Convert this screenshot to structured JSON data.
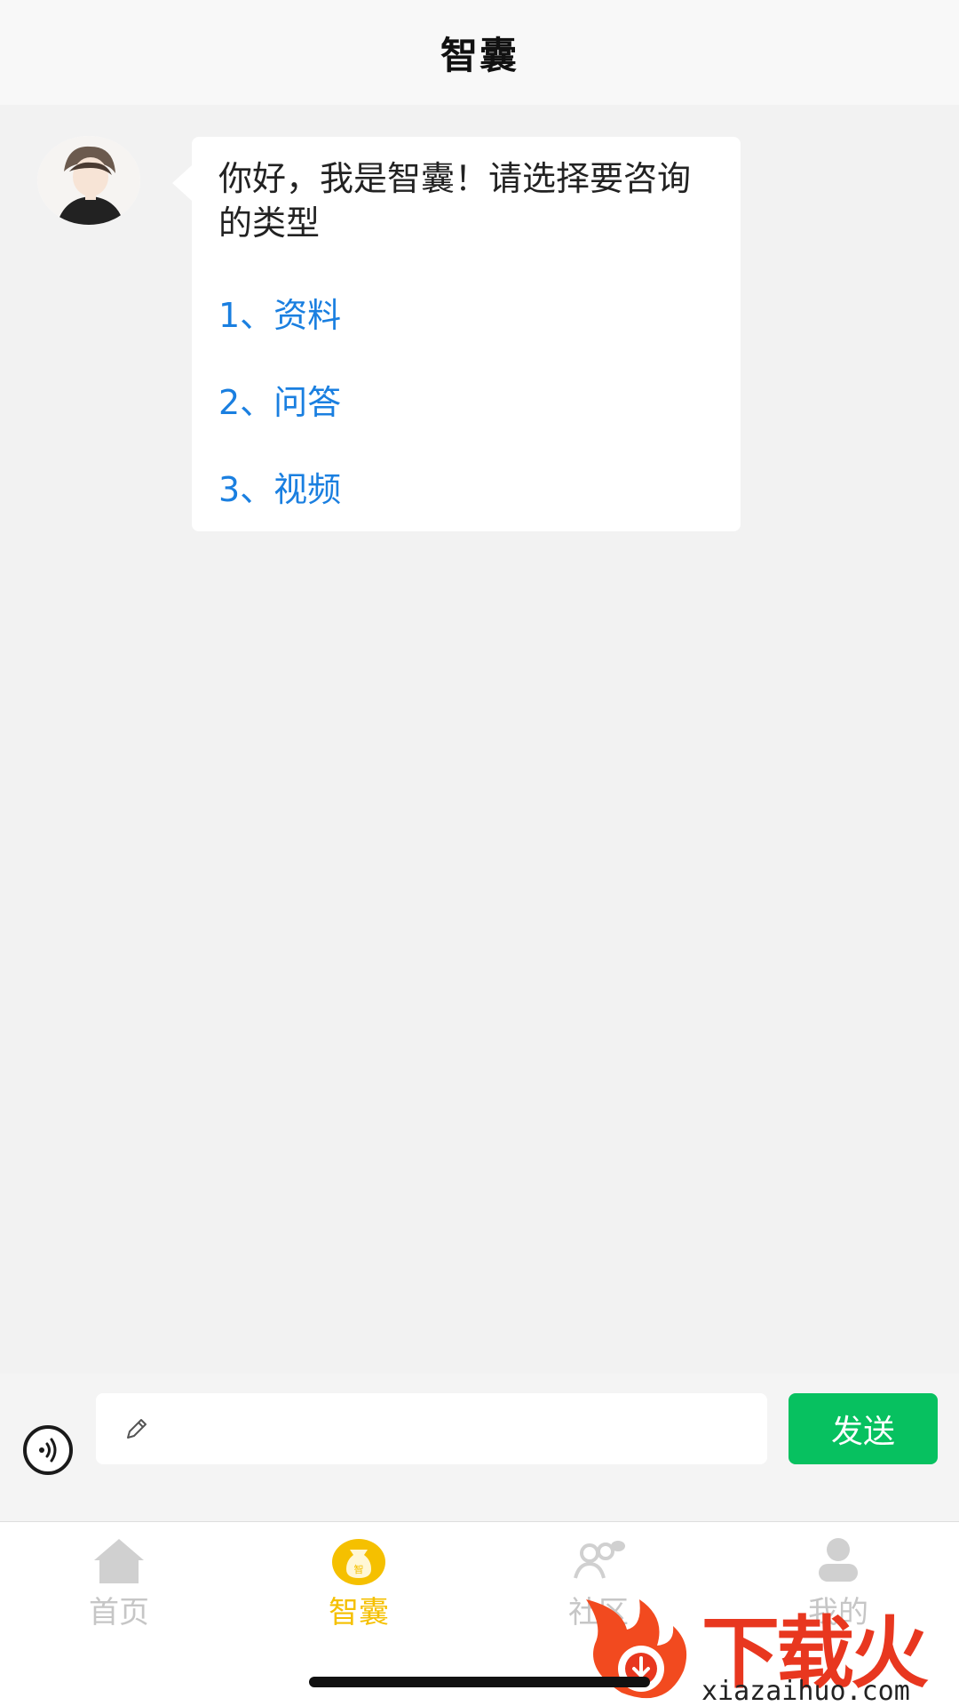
{
  "header": {
    "title": "智囊"
  },
  "chat": {
    "greeting": "你好，我是智囊！请选择要咨询的类型",
    "options": [
      {
        "label": "1、资料"
      },
      {
        "label": "2、问答"
      },
      {
        "label": "3、视频"
      }
    ]
  },
  "input_bar": {
    "input_value": "",
    "send_label": "发送"
  },
  "tabbar": {
    "tabs": [
      {
        "label": "首页",
        "icon": "home-icon",
        "active": false
      },
      {
        "label": "智囊",
        "icon": "brain-bag-icon",
        "active": true
      },
      {
        "label": "社区",
        "icon": "community-icon",
        "active": false
      },
      {
        "label": "我的",
        "icon": "profile-icon",
        "active": false
      }
    ]
  },
  "watermark": {
    "brand": "下载火",
    "url": "xiazaihuo.com"
  },
  "colors": {
    "active_tab": "#f5c000",
    "send_button": "#07c160",
    "link": "#1a7fe0"
  }
}
